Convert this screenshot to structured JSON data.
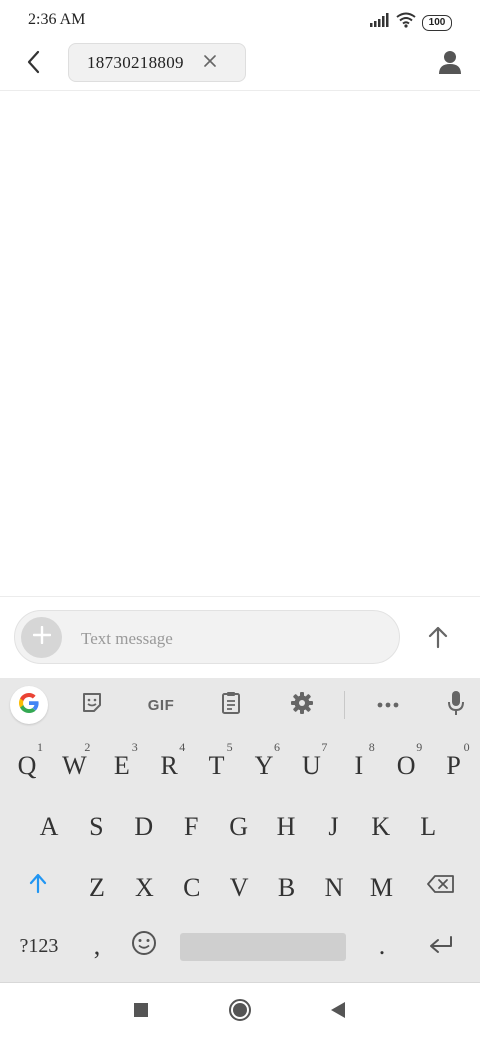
{
  "status_bar": {
    "time": "2:36 AM",
    "battery": "100",
    "icons": [
      "signal-icon",
      "wifi-icon",
      "battery-icon"
    ]
  },
  "header": {
    "recipient": "18730218809",
    "icons": [
      "back-arrow-icon",
      "close-icon",
      "person-icon"
    ]
  },
  "compose": {
    "placeholder": "Text message",
    "value": "",
    "icons": [
      "plus-icon",
      "send-arrow-icon"
    ]
  },
  "keyboard": {
    "toolbar": {
      "gif_label": "GIF",
      "icons": [
        "google-g-icon",
        "sticker-icon",
        "gif-icon",
        "clipboard-icon",
        "settings-gear-icon",
        "more-dots-icon",
        "microphone-icon"
      ]
    },
    "row1": [
      {
        "key": "Q",
        "hint": "1"
      },
      {
        "key": "W",
        "hint": "2"
      },
      {
        "key": "E",
        "hint": "3"
      },
      {
        "key": "R",
        "hint": "4"
      },
      {
        "key": "T",
        "hint": "5"
      },
      {
        "key": "Y",
        "hint": "6"
      },
      {
        "key": "U",
        "hint": "7"
      },
      {
        "key": "I",
        "hint": "8"
      },
      {
        "key": "O",
        "hint": "9"
      },
      {
        "key": "P",
        "hint": "0"
      }
    ],
    "row2": [
      "A",
      "S",
      "D",
      "F",
      "G",
      "H",
      "J",
      "K",
      "L"
    ],
    "row3": [
      "Z",
      "X",
      "C",
      "V",
      "B",
      "N",
      "M"
    ],
    "sym_key": "?123",
    "comma_key": ",",
    "period_key": ".",
    "accent_color": "#2196f3"
  },
  "nav_bar": {
    "icons": [
      "recents-square-icon",
      "home-circle-icon",
      "back-triangle-icon"
    ]
  }
}
